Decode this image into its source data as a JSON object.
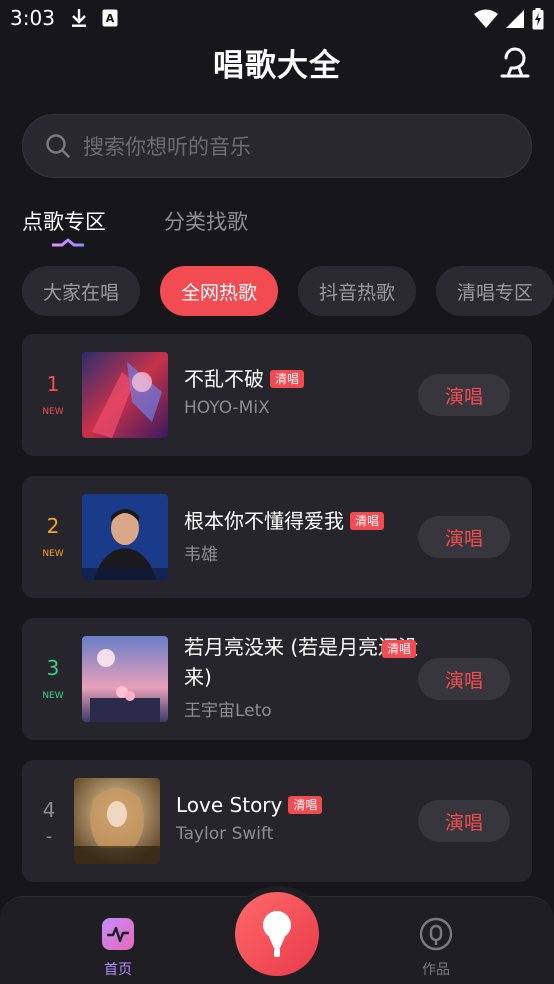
{
  "status_bar": {
    "time": "3:03",
    "icons": [
      "download-icon",
      "font-a-icon",
      "wifi-icon",
      "signal-icon",
      "battery-icon"
    ]
  },
  "header": {
    "title": "唱歌大全",
    "right_icon": "singer-profile-icon"
  },
  "search": {
    "placeholder": "搜索你想听的音乐"
  },
  "tabs": [
    {
      "label": "点歌专区",
      "active": true
    },
    {
      "label": "分类找歌",
      "active": false
    }
  ],
  "chips": [
    {
      "label": "大家在唱",
      "active": false
    },
    {
      "label": "全网热歌",
      "active": true
    },
    {
      "label": "抖音热歌",
      "active": false
    },
    {
      "label": "清唱专区",
      "active": false
    }
  ],
  "songs": [
    {
      "rank": "1",
      "badge": "NEW",
      "rank_color": "#f24b52",
      "title": "不乱不破",
      "tag": "清唱",
      "artist": "HOYO-MiX",
      "button": "演唱"
    },
    {
      "rank": "2",
      "badge": "NEW",
      "rank_color": "#f5a623",
      "title": "根本你不懂得爱我",
      "tag": "清唱",
      "artist": "韦雄",
      "button": "演唱"
    },
    {
      "rank": "3",
      "badge": "NEW",
      "rank_color": "#3ecf8e",
      "title": "若月亮没来 (若是月亮还没来)",
      "tag": "清唱",
      "artist": "王宇宙Leto",
      "button": "演唱"
    },
    {
      "rank": "4",
      "badge": "-",
      "rank_color": "#8d8d93",
      "title": "Love Story",
      "tag": "清唱",
      "artist": "Taylor Swift",
      "button": "演唱"
    }
  ],
  "bottom_nav": {
    "home_label": "首页",
    "works_label": "作品",
    "active_color": "#b58cff",
    "inactive_color": "#7a7a80"
  },
  "colors": {
    "accent": "#f24b52",
    "background": "#17171b",
    "card": "#25252b"
  }
}
